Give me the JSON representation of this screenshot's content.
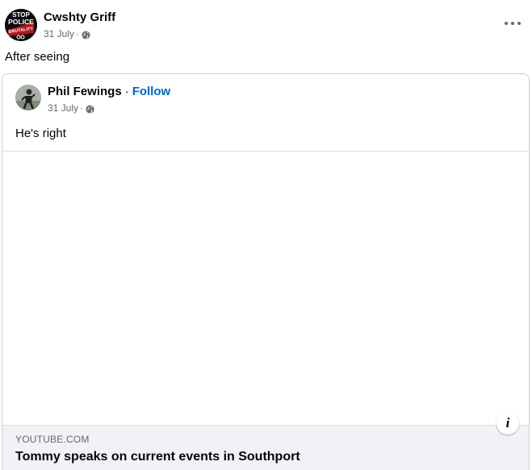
{
  "post": {
    "author": "Cwshty Griff",
    "date": "31 July",
    "meta_separator": "·",
    "privacy_icon": "globe-icon",
    "text": "After seeing",
    "avatar_text": [
      "STOP",
      "POLICE",
      "BRUTALITY"
    ]
  },
  "shared_post": {
    "author": "Phil Fewings",
    "separator": "·",
    "follow_label": "Follow",
    "date": "31 July",
    "meta_separator": "·",
    "privacy_icon": "globe-icon",
    "text": "He's right"
  },
  "link_preview": {
    "domain": "YOUTUBE.COM",
    "title": "Tommy speaks on current events in Southport",
    "info_icon_label": "i"
  },
  "colors": {
    "link": "#0064d1",
    "meta": "#65676b",
    "footer_bg": "#f0f2f5"
  }
}
